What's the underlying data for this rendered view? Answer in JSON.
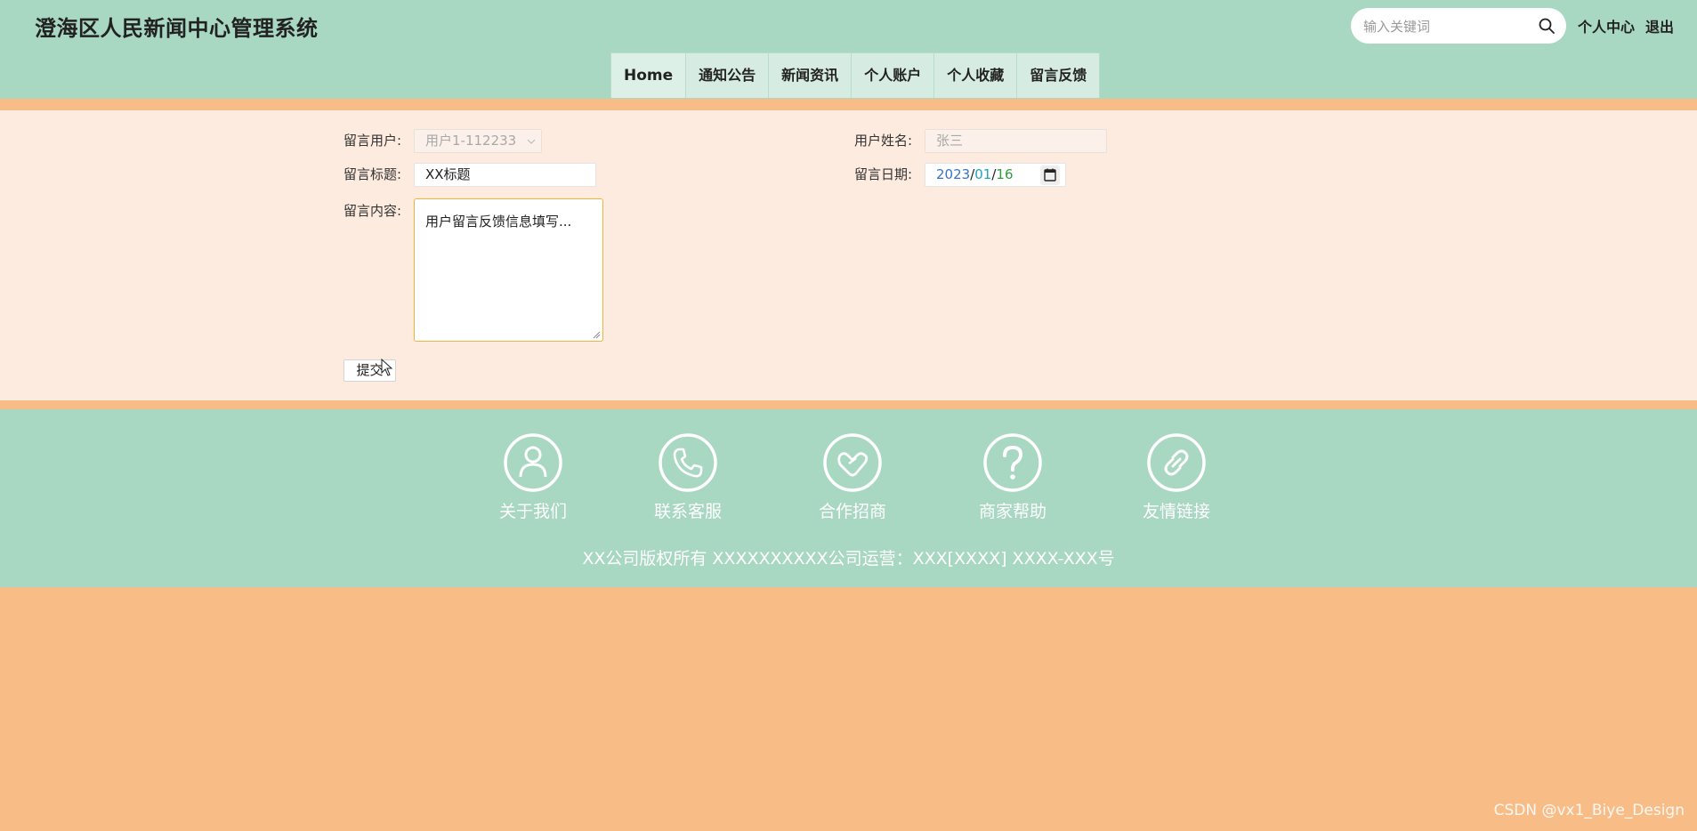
{
  "header": {
    "site_title": "澄海区人民新闻中心管理系统",
    "search_placeholder": "输入关键词",
    "user_center": "个人中心",
    "logout": "退出"
  },
  "nav": {
    "items": [
      "Home",
      "通知公告",
      "新闻资讯",
      "个人账户",
      "个人收藏",
      "留言反馈"
    ],
    "active": "Home"
  },
  "form": {
    "user_label": "留言用户:",
    "user_value": "用户1-112233",
    "name_label": "用户姓名:",
    "name_value": "张三",
    "title_label": "留言标题:",
    "title_value": "XX标题",
    "date_label": "留言日期:",
    "date_year": "2023",
    "date_month": "01",
    "date_day": "16",
    "date_sep": "/",
    "content_label": "留言内容:",
    "content_value": "用户留言反馈信息填写...",
    "submit_label": "提交"
  },
  "footer": {
    "links": [
      "关于我们",
      "联系客服",
      "合作招商",
      "商家帮助",
      "友情链接"
    ],
    "copyright": "XX公司版权所有 XXXXXXXXXX公司运营：XXX[XXXX] XXXX-XXX号"
  },
  "watermark": "CSDN @vx1_Biye_Design",
  "colors": {
    "header_bg": "#a8d7c2",
    "band_bg": "#f8bd87",
    "form_bg": "#fcebde",
    "textarea_border": "#f0b43c"
  }
}
